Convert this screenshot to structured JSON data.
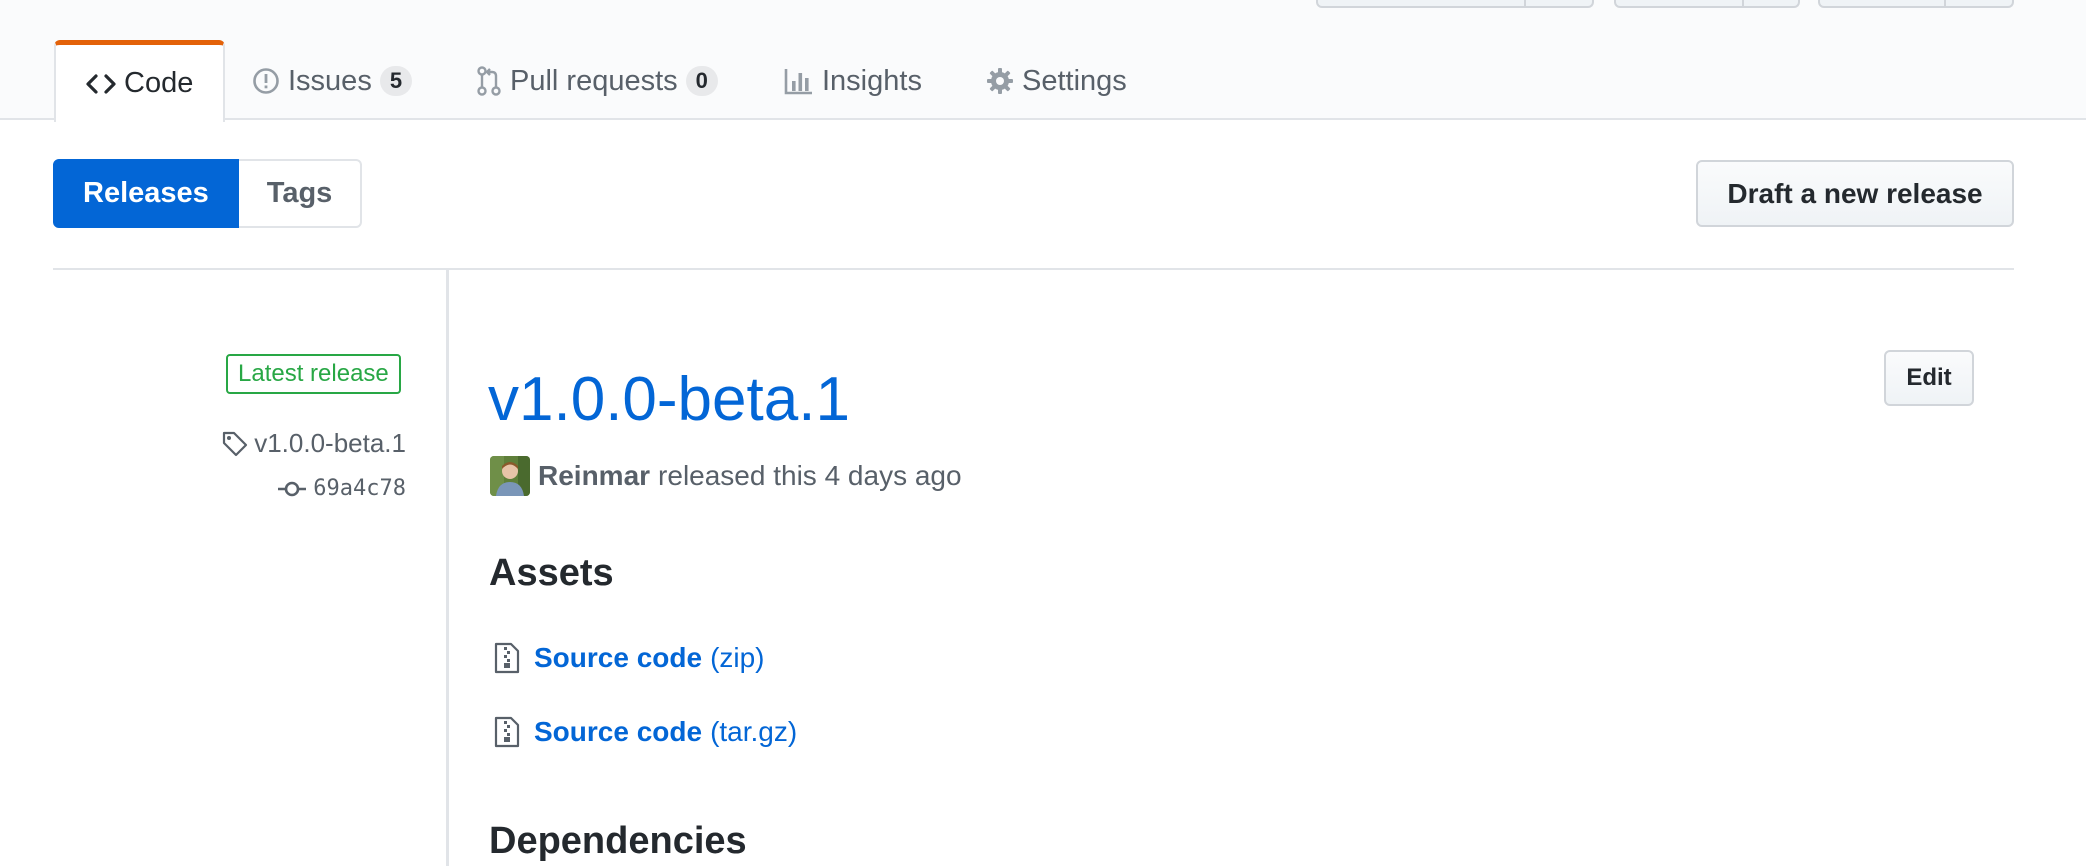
{
  "tabs": [
    {
      "label": "Code",
      "icon": "code-icon",
      "selected": true
    },
    {
      "label": "Issues",
      "icon": "issue-opened-icon",
      "count": "5"
    },
    {
      "label": "Pull requests",
      "icon": "git-pull-request-icon",
      "count": "0"
    },
    {
      "label": "Insights",
      "icon": "graph-icon"
    },
    {
      "label": "Settings",
      "icon": "gear-icon"
    }
  ],
  "subnav": {
    "releases": "Releases",
    "tags": "Tags"
  },
  "actions": {
    "draft_release": "Draft a new release",
    "edit": "Edit"
  },
  "release": {
    "badge": "Latest release",
    "tag": "v1.0.0-beta.1",
    "commit": "69a4c78",
    "title": "v1.0.0-beta.1",
    "author": "Reinmar",
    "released_text": "released this 4 days ago"
  },
  "assets": {
    "heading": "Assets",
    "items": [
      {
        "name": "Source code",
        "format": "(zip)",
        "icon": "file-zip-icon"
      },
      {
        "name": "Source code",
        "format": "(tar.gz)",
        "icon": "file-zip-icon"
      }
    ]
  },
  "dependencies": {
    "heading": "Dependencies"
  },
  "colors": {
    "accent": "#0366d6",
    "selected_tab_border": "#e36209",
    "latest_badge": "#28a745"
  }
}
